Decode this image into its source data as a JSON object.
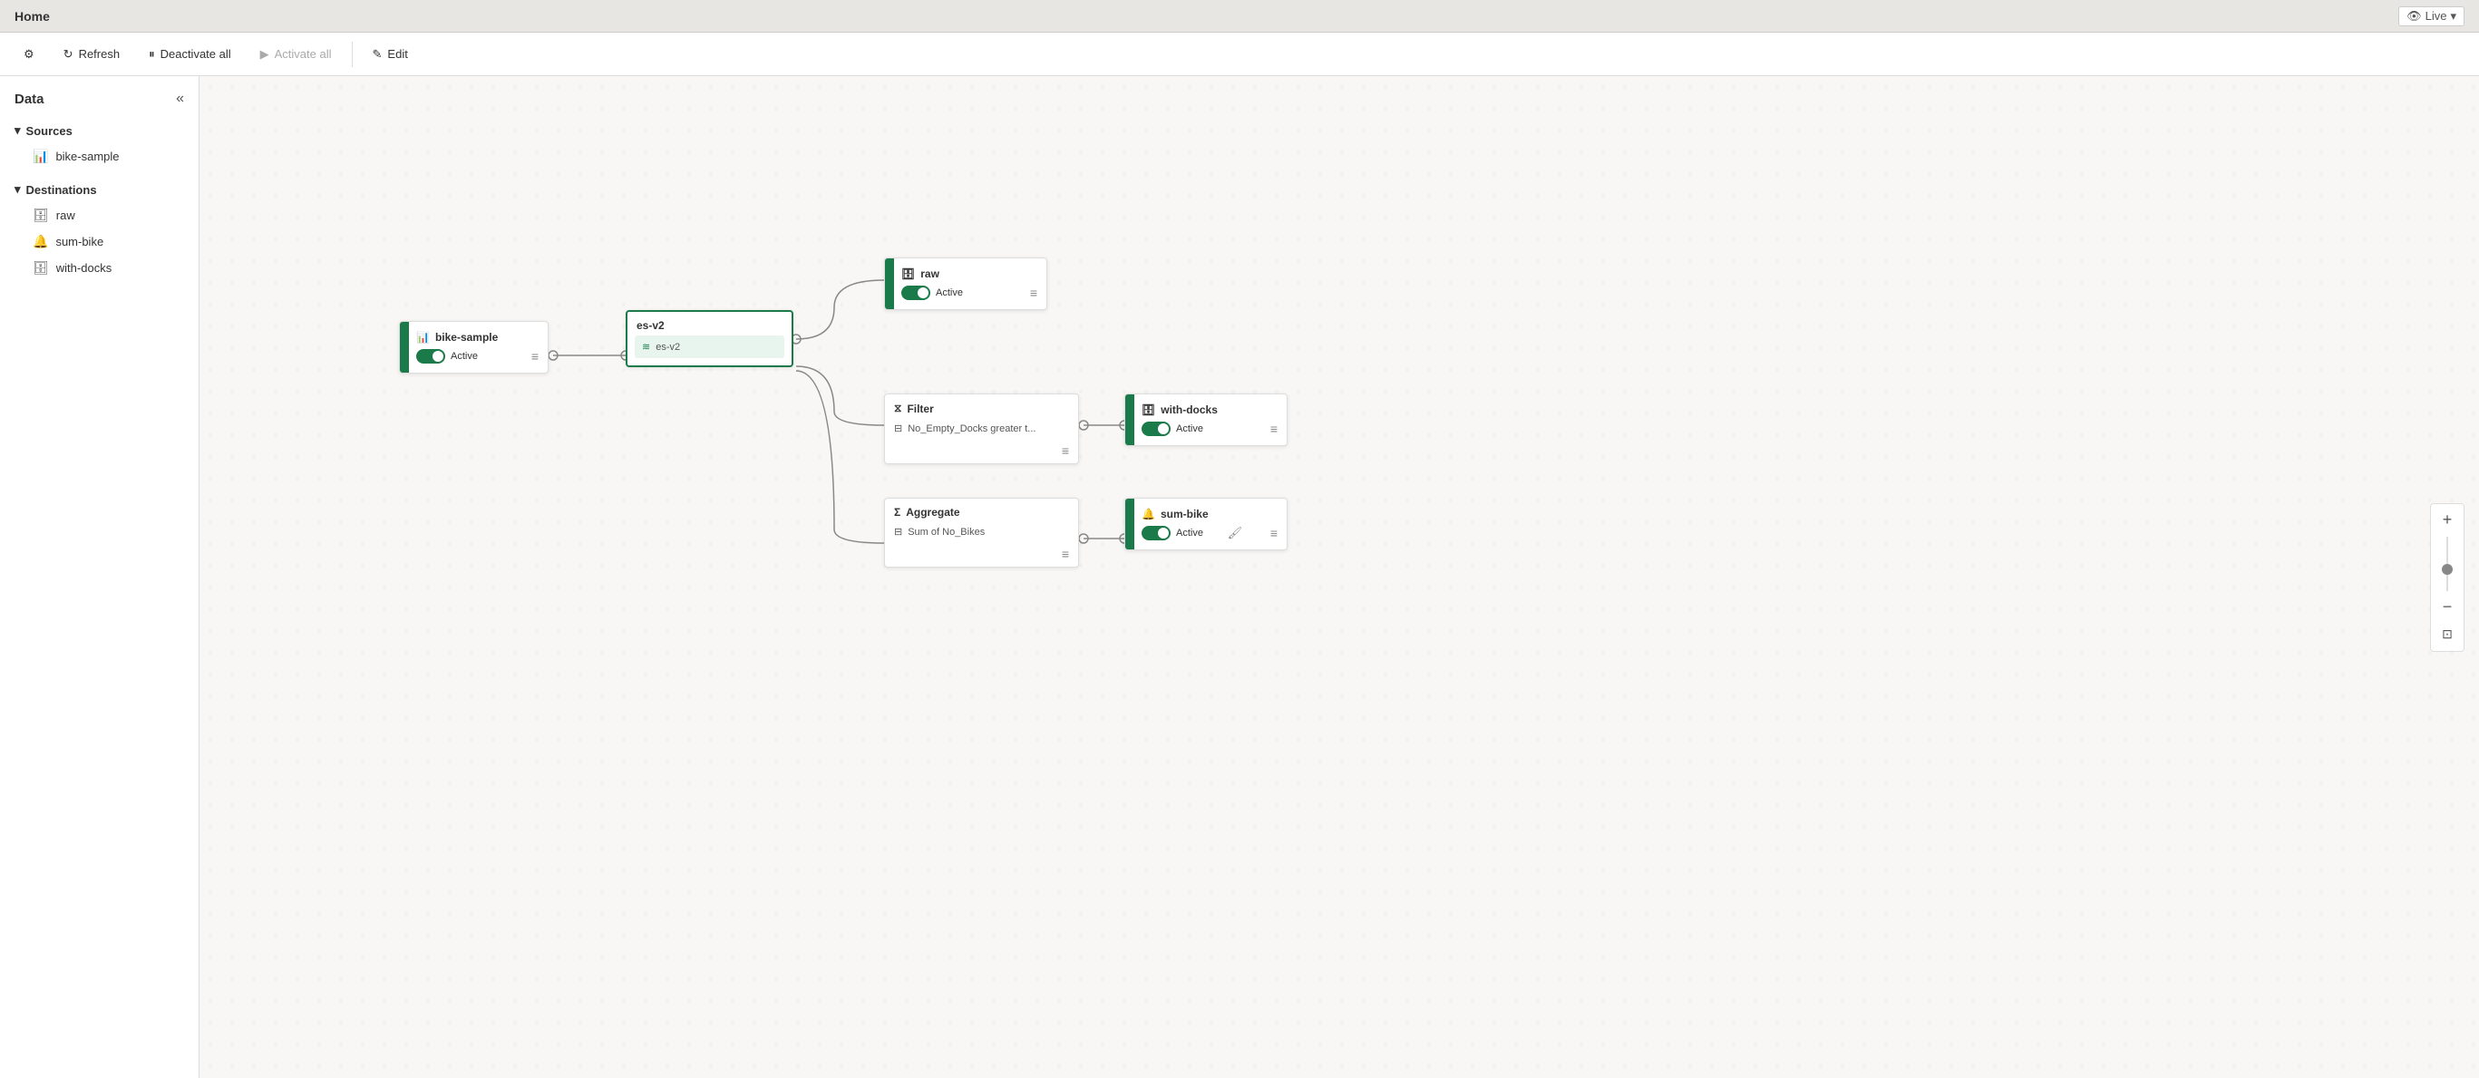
{
  "titleBar": {
    "title": "Home",
    "liveLabel": "Live"
  },
  "toolbar": {
    "settingsLabel": "⚙",
    "refreshLabel": "Refresh",
    "deactivateAllLabel": "Deactivate all",
    "activateAllLabel": "Activate all",
    "editLabel": "Edit"
  },
  "sidebar": {
    "title": "Data",
    "collapseIcon": "«",
    "sections": [
      {
        "label": "Sources",
        "items": [
          {
            "label": "bike-sample",
            "icon": "📊"
          }
        ]
      },
      {
        "label": "Destinations",
        "items": [
          {
            "label": "raw",
            "icon": "🗄"
          },
          {
            "label": "sum-bike",
            "icon": "🔔"
          },
          {
            "label": "with-docks",
            "icon": "🗄"
          }
        ]
      }
    ]
  },
  "nodes": {
    "source": {
      "title": "bike-sample",
      "status": "Active"
    },
    "center": {
      "title": "es-v2",
      "subLabel": "es-v2"
    },
    "raw": {
      "title": "raw",
      "status": "Active"
    },
    "filter": {
      "title": "Filter",
      "condition": "No_Empty_Docks greater t..."
    },
    "withDocks": {
      "title": "with-docks",
      "status": "Active"
    },
    "aggregate": {
      "title": "Aggregate",
      "condition": "Sum of No_Bikes"
    },
    "sumBike": {
      "title": "sum-bike",
      "status": "Active"
    }
  },
  "zoom": {
    "plusLabel": "+",
    "minusLabel": "−"
  }
}
